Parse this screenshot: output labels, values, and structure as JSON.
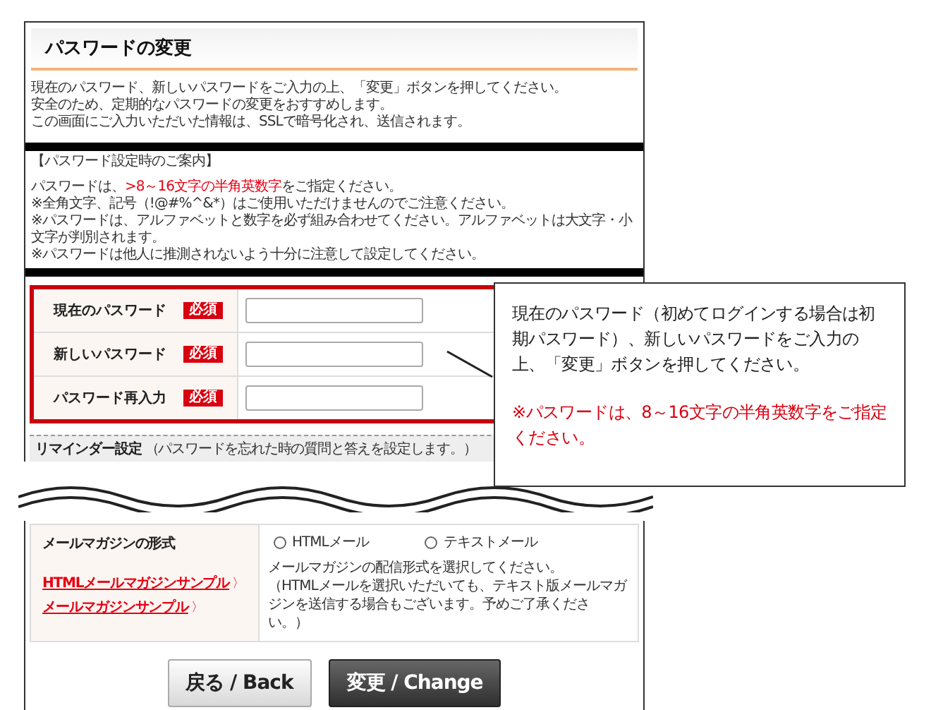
{
  "page_title": "パスワードの変更",
  "intro": [
    "現在のパスワード、新しいパスワードをご入力の上、「変更」ボタンを押してください。",
    "安全のため、定期的なパスワードの変更をおすすめします。",
    "この画面にご入力いただいた情報は、SSLで暗号化され、送信されます。"
  ],
  "guide": {
    "heading": "【パスワード設定時のご案内】",
    "rule": {
      "before": "パスワードは、",
      "emphasis": ">8～16文字の半角英数字",
      "after": "をご指定ください。"
    },
    "notes": [
      "※全角文字、記号（!@#%^&*）はご使用いただけませんのでご注意ください。",
      "※パスワードは、アルファベットと数字を必ず組み合わせてください。アルファベットは大文字・小文字が判別されます。",
      "※パスワードは他人に推測されないよう十分に注意して設定してください。"
    ]
  },
  "password_fields": [
    {
      "label": "現在のパスワード",
      "badge": "必須"
    },
    {
      "label": "新しいパスワード",
      "badge": "必須"
    },
    {
      "label": "パスワード再入力",
      "badge": "必須"
    }
  ],
  "reminder": {
    "title": "リマインダー設定",
    "note": "（パスワードを忘れた時の質問と答えを設定します。）"
  },
  "newsletter": {
    "label": "メールマガジンの形式",
    "links": [
      {
        "text": "HTMLメールマガジンサンプル",
        "arrow": "〉"
      },
      {
        "text": "メールマガジンサンプル",
        "arrow": "〉"
      }
    ],
    "options": [
      {
        "label": "HTMLメール",
        "selected": false
      },
      {
        "label": "テキストメール",
        "selected": false
      }
    ],
    "description": [
      "メールマガジンの配信形式を選択してください。",
      "（HTMLメールを選択いただいても、テキスト版メールマガジンを送信する場合もございます。予めご了承ください。）"
    ]
  },
  "buttons": [
    {
      "label": "戻る / Back",
      "kind": "secondary"
    },
    {
      "label": "変更 / Change",
      "kind": "primary"
    }
  ],
  "callout": {
    "text": "現在のパスワード（初めてログインする場合は初期パスワード）、新しいパスワードをご入力の上、「変更」ボタンを押してください。",
    "note": "※パスワードは、8～16文字の半角英数字をご指定ください。"
  }
}
